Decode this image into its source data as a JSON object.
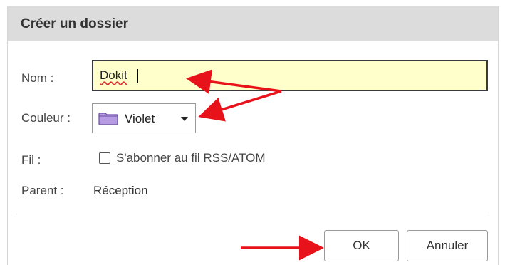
{
  "dialog": {
    "title": "Créer un dossier",
    "fields": {
      "name_label": "Nom :",
      "name_value": "Dokit",
      "color_label": "Couleur :",
      "color_value": "Violet",
      "feed_label": "Fil :",
      "feed_checkbox_label": "S'abonner au fil RSS/ATOM",
      "feed_checked": false,
      "parent_label": "Parent :",
      "parent_value": "Réception"
    },
    "buttons": {
      "ok": "OK",
      "cancel": "Annuler"
    }
  },
  "colors": {
    "titlebar": "#dcdcdc",
    "name_input_bg": "#ffffcc",
    "folder_icon": "#b79be3",
    "annotation_arrow": "#e8121b"
  },
  "icons": {
    "folder": "folder-icon",
    "dropdown": "caret-down-icon",
    "checkbox": "checkbox-icon"
  }
}
